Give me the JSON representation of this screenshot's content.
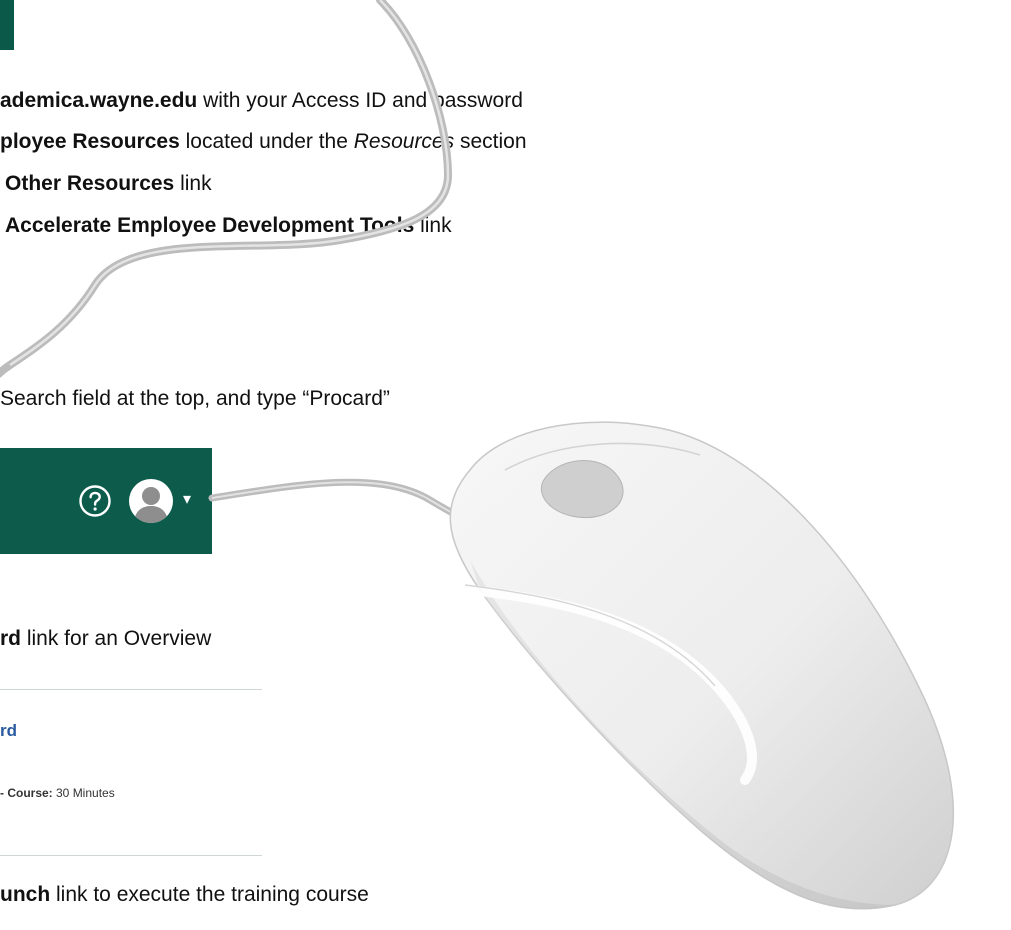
{
  "steps": {
    "s1": {
      "bold": "ademica.wayne.edu",
      "rest": " with your Access ID and password"
    },
    "s2": {
      "bold": "ployee Resources",
      "mid": " located under the ",
      "italic": "Resources",
      "rest": " section"
    },
    "s3": {
      "bold": "Other Resources",
      "rest": " link"
    },
    "s4": {
      "bold": "Accelerate Employee Development Tools",
      "rest": " link"
    },
    "s5": {
      "text": "Search field at the top, and type “Procard”"
    },
    "s6": {
      "bold": "rd",
      "rest": " link for an Overview"
    },
    "s7": {
      "bold": "unch",
      "rest": " link to execute the training course"
    }
  },
  "header_bar": {
    "help_icon": "help-circle-icon",
    "avatar_icon": "user-avatar-icon",
    "caret": "▾"
  },
  "course_result": {
    "title": "rd",
    "meta_label": "- Course:",
    "meta_value": " 30 Minutes"
  },
  "colors": {
    "header_green": "#0d5b4b",
    "link_blue": "#2a5aa0",
    "text": "#111111"
  }
}
